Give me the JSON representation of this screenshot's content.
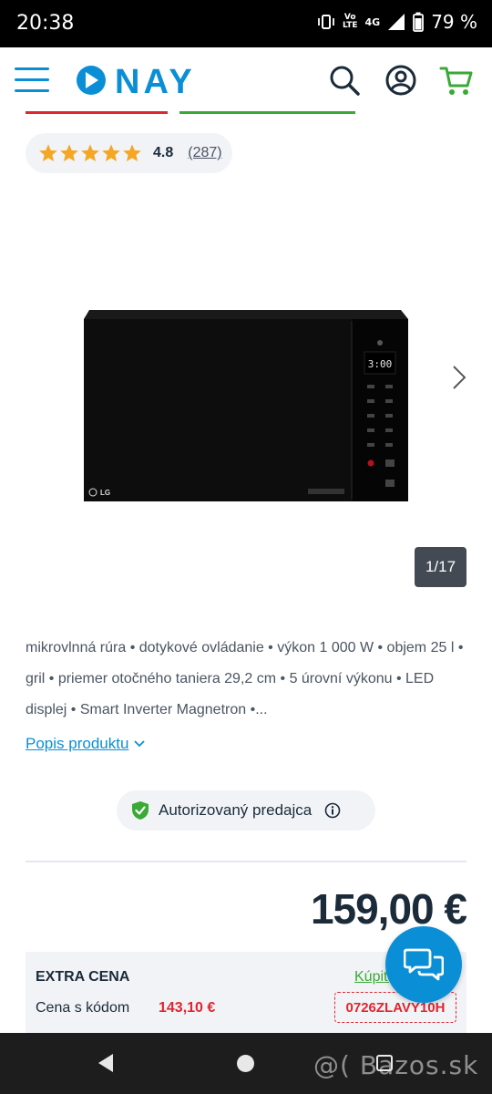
{
  "status_bar": {
    "time": "20:38",
    "volte_top": "Vo",
    "volte_bottom": "LTE",
    "network": "4G",
    "battery": "79 %",
    "icons": [
      "vibrate-icon",
      "volte-icon",
      "signal-icon",
      "battery-icon"
    ]
  },
  "header": {
    "logo_text": "NAY",
    "icons": [
      "menu-icon",
      "search-icon",
      "account-icon",
      "cart-icon"
    ],
    "colors": {
      "brand_blue": "#0a8fd7",
      "cart_green": "#3aa935",
      "accent_red": "#e0262f",
      "accent_green": "#3aa935"
    }
  },
  "rating": {
    "stars": 5,
    "value": "4.8",
    "count": "(287)",
    "star_color": "#f5a623"
  },
  "gallery": {
    "image_brand": "LG",
    "display_text": "3:00",
    "counter": "1/17"
  },
  "description": {
    "text": "mikrovlnná rúra • dotykové ovládanie • výkon 1 000 W • objem 25 l • gril • priemer otočného taniera 29,2 cm • 5 úrovní výkonu • LED displej • Smart Inverter Magnetron •...",
    "link_label": "Popis produktu"
  },
  "authorized": {
    "label": "Autorizovaný predajca"
  },
  "price": {
    "main": "159,00 €"
  },
  "extra_price": {
    "title": "EXTRA CENA",
    "buy_label": "Kúpiť",
    "code_label": "Cena s kódom",
    "code_price": "143,10 €",
    "code": "0726ZLAVY10H"
  },
  "watermark": "@( Bazos.sk"
}
